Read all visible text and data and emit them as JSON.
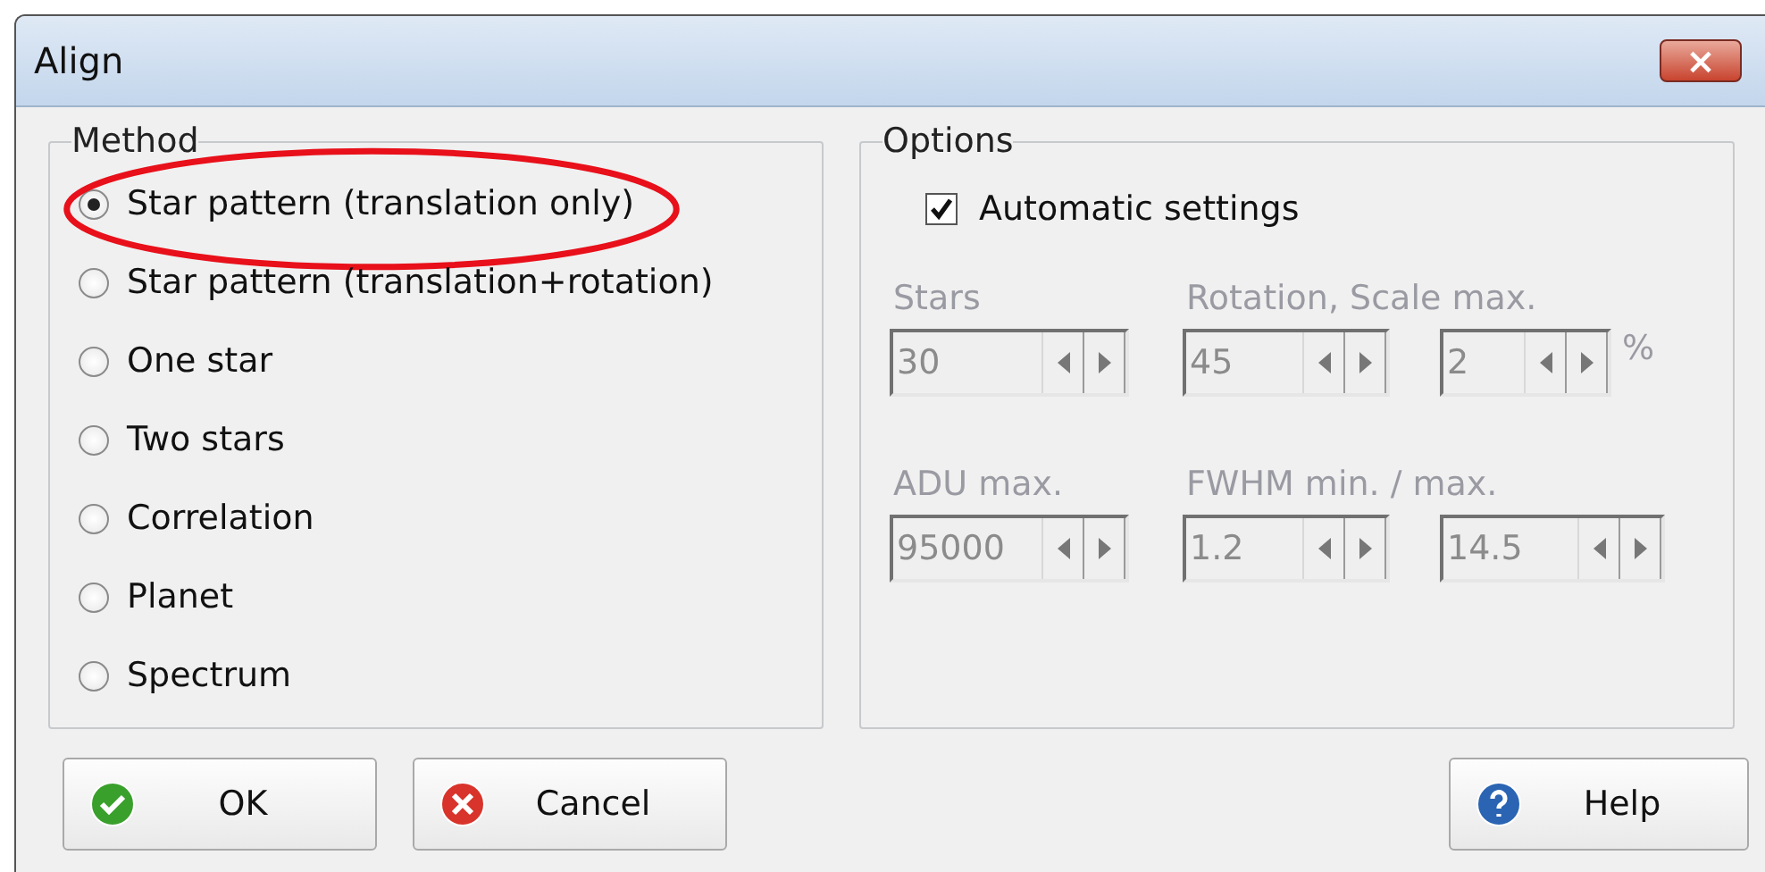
{
  "window": {
    "title": "Align",
    "close_button": {
      "label": "×"
    }
  },
  "method": {
    "title": "Method",
    "options": [
      {
        "label": "Star pattern (translation only)",
        "selected": true,
        "highlighted": true
      },
      {
        "label": "Star pattern (translation+rotation)",
        "selected": false,
        "highlighted": false
      },
      {
        "label": "One star",
        "selected": false,
        "highlighted": false
      },
      {
        "label": "Two stars",
        "selected": false,
        "highlighted": false
      },
      {
        "label": "Correlation",
        "selected": false,
        "highlighted": false
      },
      {
        "label": "Planet",
        "selected": false,
        "highlighted": false
      },
      {
        "label": "Spectrum",
        "selected": false,
        "highlighted": false
      }
    ]
  },
  "options": {
    "title": "Options",
    "automatic": {
      "label": "Automatic settings",
      "checked": true
    },
    "rows": [
      {
        "groups": [
          {
            "label": "Stars",
            "fields": [
              {
                "value": "30",
                "disabled": true
              }
            ]
          },
          {
            "label": "Rotation, Scale max.",
            "fields": [
              {
                "value": "45",
                "disabled": true
              },
              {
                "value": "2",
                "disabled": true,
                "unit": "%"
              }
            ]
          }
        ]
      },
      {
        "groups": [
          {
            "label": "ADU max.",
            "fields": [
              {
                "value": "95000",
                "disabled": true
              }
            ]
          },
          {
            "label": "FWHM min. / max.",
            "fields": [
              {
                "value": "1.2",
                "disabled": true
              },
              {
                "value": "14.5",
                "disabled": true
              }
            ]
          }
        ]
      }
    ]
  },
  "buttons": [
    {
      "label": "OK",
      "kind": "ok"
    },
    {
      "label": "Cancel",
      "kind": "cancel"
    },
    {
      "label": "Help",
      "kind": "help"
    }
  ]
}
